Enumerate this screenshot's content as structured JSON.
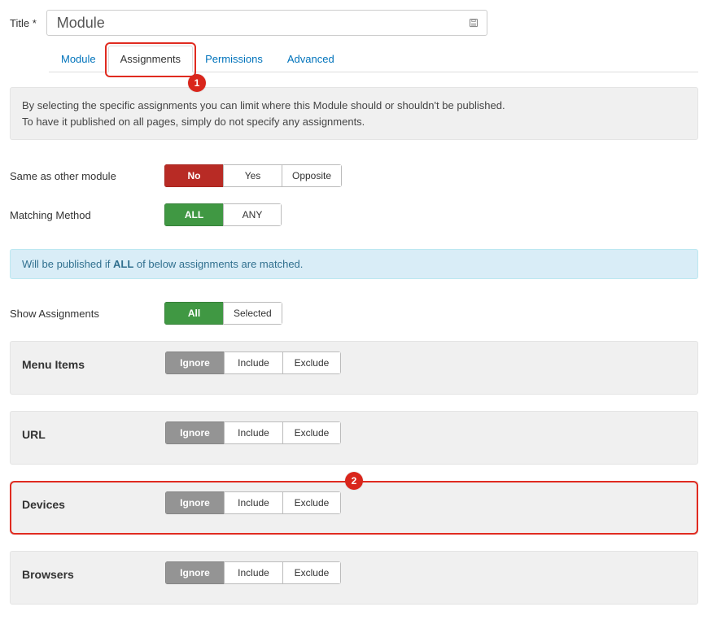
{
  "title": {
    "label": "Title *",
    "value": "Module"
  },
  "tabs": [
    {
      "label": "Module",
      "active": false
    },
    {
      "label": "Assignments",
      "active": true
    },
    {
      "label": "Permissions",
      "active": false
    },
    {
      "label": "Advanced",
      "active": false
    }
  ],
  "info": {
    "line1": "By selecting the specific assignments you can limit where this Module should or shouldn't be published.",
    "line2": "To have it published on all pages, simply do not specify any assignments."
  },
  "same_as": {
    "label": "Same as other module",
    "opts": [
      "No",
      "Yes",
      "Opposite"
    ],
    "selected": 0
  },
  "matching": {
    "label": "Matching Method",
    "opts": [
      "ALL",
      "ANY"
    ],
    "selected": 0
  },
  "hint": {
    "prefix": "Will be published if ",
    "bold": "ALL",
    "suffix": " of below assignments are matched."
  },
  "show_assign": {
    "label": "Show Assignments",
    "opts": [
      "All",
      "Selected"
    ],
    "selected": 0
  },
  "assign_opts": [
    "Ignore",
    "Include",
    "Exclude"
  ],
  "blocks": [
    {
      "label": "Menu Items",
      "selected": 0
    },
    {
      "label": "URL",
      "selected": 0
    },
    {
      "label": "Devices",
      "selected": 0
    },
    {
      "label": "Browsers",
      "selected": 0
    }
  ],
  "callouts": {
    "tab": "1",
    "devices": "2"
  }
}
